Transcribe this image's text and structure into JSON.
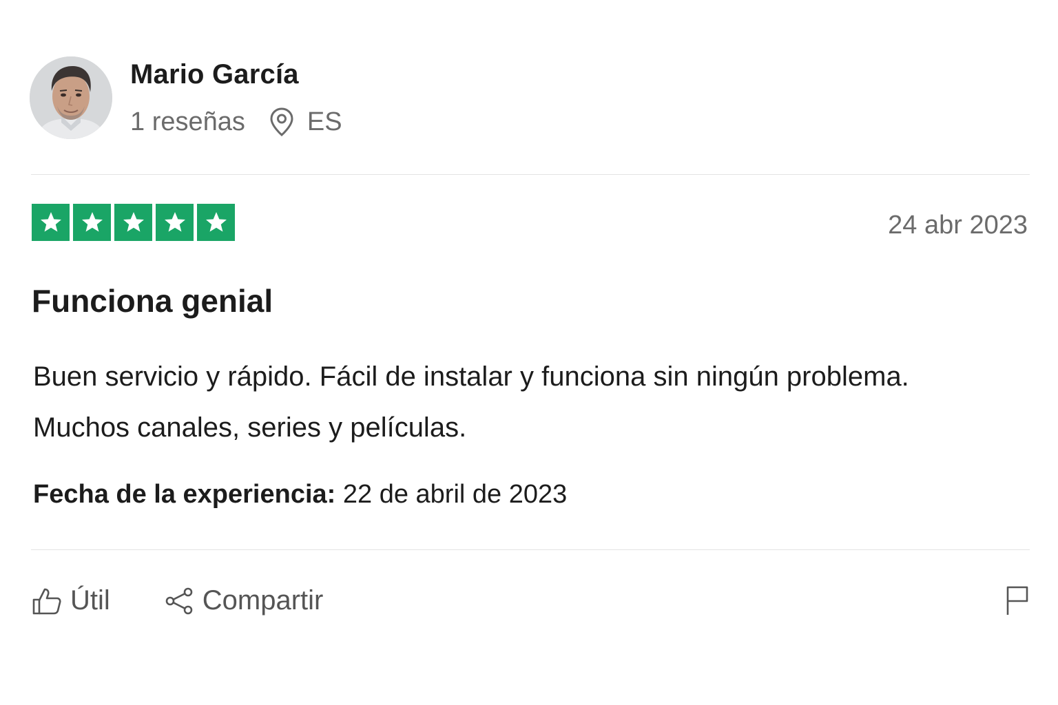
{
  "reviewer": {
    "name": "Mario García",
    "reviews_count": "1 reseñas",
    "country": "ES",
    "icons": {
      "location": "location-pin-icon"
    }
  },
  "review": {
    "rating": 5,
    "rating_max": 5,
    "star_color": "#1aa566",
    "date": "24 abr 2023",
    "title": "Funciona genial",
    "body_line1": "Buen servicio y rápido. Fácil de instalar y funciona sin ningún problema.",
    "body_line2": "Muchos canales, series y películas.",
    "experience_label": "Fecha de la experiencia:",
    "experience_date": " 22 de abril de 2023"
  },
  "actions": {
    "useful_label": "Útil",
    "share_label": "Compartir",
    "icons": {
      "useful": "thumbs-up-icon",
      "share": "share-icon",
      "report": "flag-icon"
    }
  }
}
